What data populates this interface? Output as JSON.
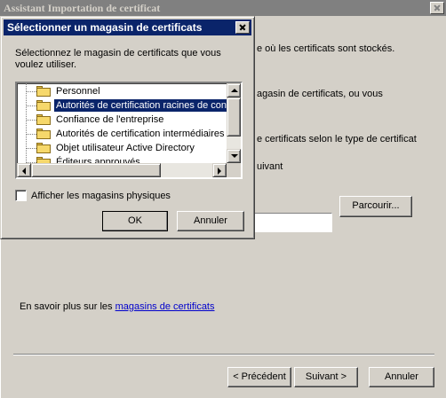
{
  "wizard": {
    "title": "Assistant Importation de certificat",
    "text_line1": "e où les certificats sont stockés.",
    "text_line2": "agasin de certificats, ou vous",
    "text_line3": "e certificats selon le type de certificat",
    "text_line4": "uivant",
    "browse_label": "Parcourir...",
    "learn_more_prefix": "En savoir plus sur les ",
    "learn_more_link": "magasins de certificats",
    "back_label": "< Précédent",
    "next_label": "Suivant >",
    "cancel_label": "Annuler"
  },
  "dialog": {
    "title": "Sélectionner un magasin de certificats",
    "prompt": "Sélectionnez le magasin de certificats que vous voulez utiliser.",
    "stores": [
      {
        "label": "Personnel",
        "selected": false
      },
      {
        "label": "Autorités de certification racines de confi",
        "selected": true
      },
      {
        "label": "Confiance de l'entreprise",
        "selected": false
      },
      {
        "label": "Autorités de certification intermédiaires",
        "selected": false
      },
      {
        "label": "Objet utilisateur Active Directory",
        "selected": false
      },
      {
        "label": "Éditeurs approuvés",
        "selected": false
      }
    ],
    "show_physical_label": "Afficher les magasins physiques",
    "show_physical_checked": false,
    "ok_label": "OK",
    "cancel_label": "Annuler"
  },
  "colors": {
    "active_title": "#0a246a",
    "inactive_title": "#808080",
    "face": "#d4d0c8",
    "link": "#0000cc"
  }
}
